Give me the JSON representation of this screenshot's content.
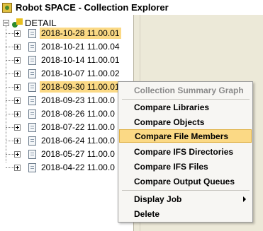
{
  "window": {
    "title": "Robot SPACE - Collection Explorer",
    "app_icon": "robot-space-app-icon"
  },
  "tree": {
    "root_label": "DETAIL",
    "root_icon": "detail-folder-icon",
    "item_icon": "collection-document-icon",
    "items": [
      {
        "label": "2018-10-28 11.00.01",
        "highlighted": true
      },
      {
        "label": "2018-10-21 11.00.04",
        "highlighted": false
      },
      {
        "label": "2018-10-14 11.00.01",
        "highlighted": false
      },
      {
        "label": "2018-10-07 11.00.02",
        "highlighted": false
      },
      {
        "label": "2018-09-30 11.00.01",
        "highlighted": true
      },
      {
        "label": "2018-09-23 11.00.0",
        "highlighted": false
      },
      {
        "label": "2018-08-26 11.00.0",
        "highlighted": false
      },
      {
        "label": "2018-07-22 11.00.0",
        "highlighted": false
      },
      {
        "label": "2018-06-24 11.00.0",
        "highlighted": false
      },
      {
        "label": "2018-05-27 11.00.0",
        "highlighted": false
      },
      {
        "label": "2018-04-22 11.00.0",
        "highlighted": false
      }
    ]
  },
  "context_menu": {
    "header": "Collection Summary Graph",
    "items": [
      "Compare Libraries",
      "Compare Objects",
      "Compare File Members",
      "Compare IFS Directories",
      "Compare IFS Files",
      "Compare Output Queues",
      "Display Job",
      "Delete"
    ],
    "active_item": "Compare File Members",
    "submenu_item": "Display Job"
  },
  "colors": {
    "highlight": "#fbd985",
    "pane_background": "#ece9d8",
    "menu_background": "#f7f6f3"
  }
}
